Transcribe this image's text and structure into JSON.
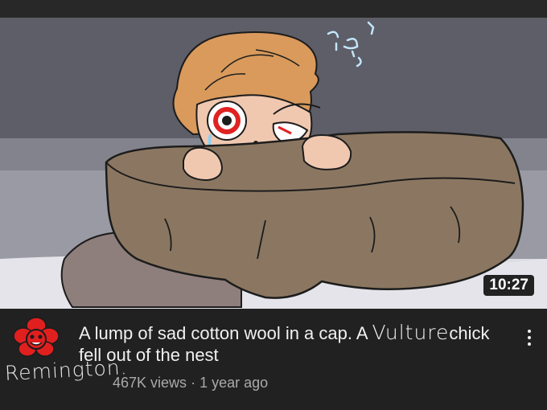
{
  "video": {
    "duration": "10:27",
    "title_part1": "A lump of sad cotton wool in a cap. A ",
    "title_hand_word": "Vulture",
    "title_part2": "chick fell out of the nest",
    "channel": "Remington",
    "channel_sep": ".",
    "views": "467K views",
    "separator": "·",
    "age": "1 year ago"
  },
  "icons": {
    "avatar": "red-flower-avatar-icon",
    "menu": "vertical-ellipsis-icon"
  },
  "colors": {
    "background": "#212121",
    "title_text": "#f1f1f1",
    "secondary_text": "#aaaaaa",
    "avatar_red": "#e01f1f"
  }
}
